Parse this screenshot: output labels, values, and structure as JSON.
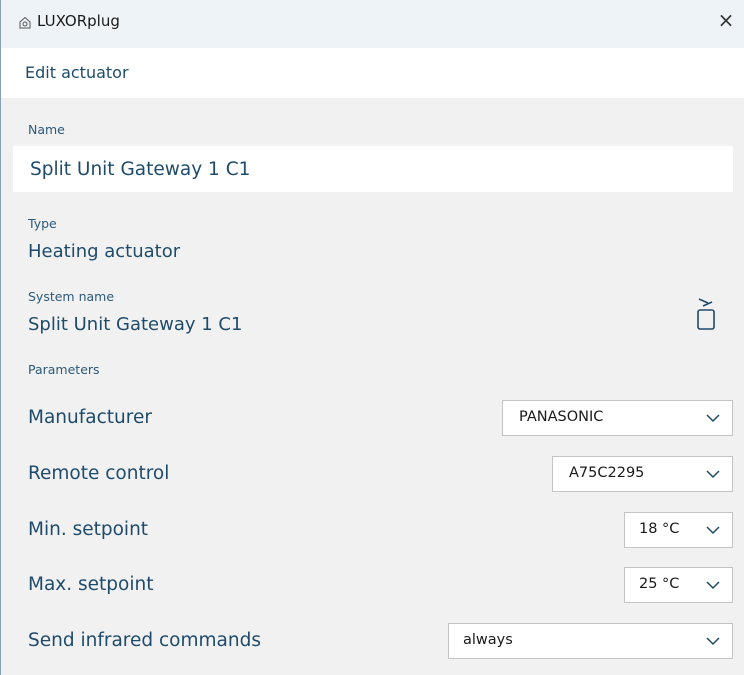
{
  "window": {
    "title": "LUXORplug",
    "close_label": "×"
  },
  "header": {
    "title": "Edit actuator"
  },
  "name": {
    "label": "Name",
    "value": "Split Unit Gateway 1 C1"
  },
  "type": {
    "label": "Type",
    "value": "Heating actuator"
  },
  "system_name": {
    "label": "System name",
    "value": "Split Unit Gateway 1 C1",
    "icon": "copy-to-name-icon"
  },
  "parameters": {
    "label": "Parameters",
    "items": [
      {
        "label": "Manufacturer",
        "value": "PANASONIC"
      },
      {
        "label": "Remote control",
        "value": "A75C2295"
      },
      {
        "label": "Min. setpoint",
        "value": "18 °C"
      },
      {
        "label": "Max. setpoint",
        "value": "25 °C"
      },
      {
        "label": "Send infrared commands",
        "value": "always"
      }
    ]
  },
  "colors": {
    "text": "#1f4b6b",
    "background": "#f1f1f1",
    "header": "#eef3f8"
  }
}
